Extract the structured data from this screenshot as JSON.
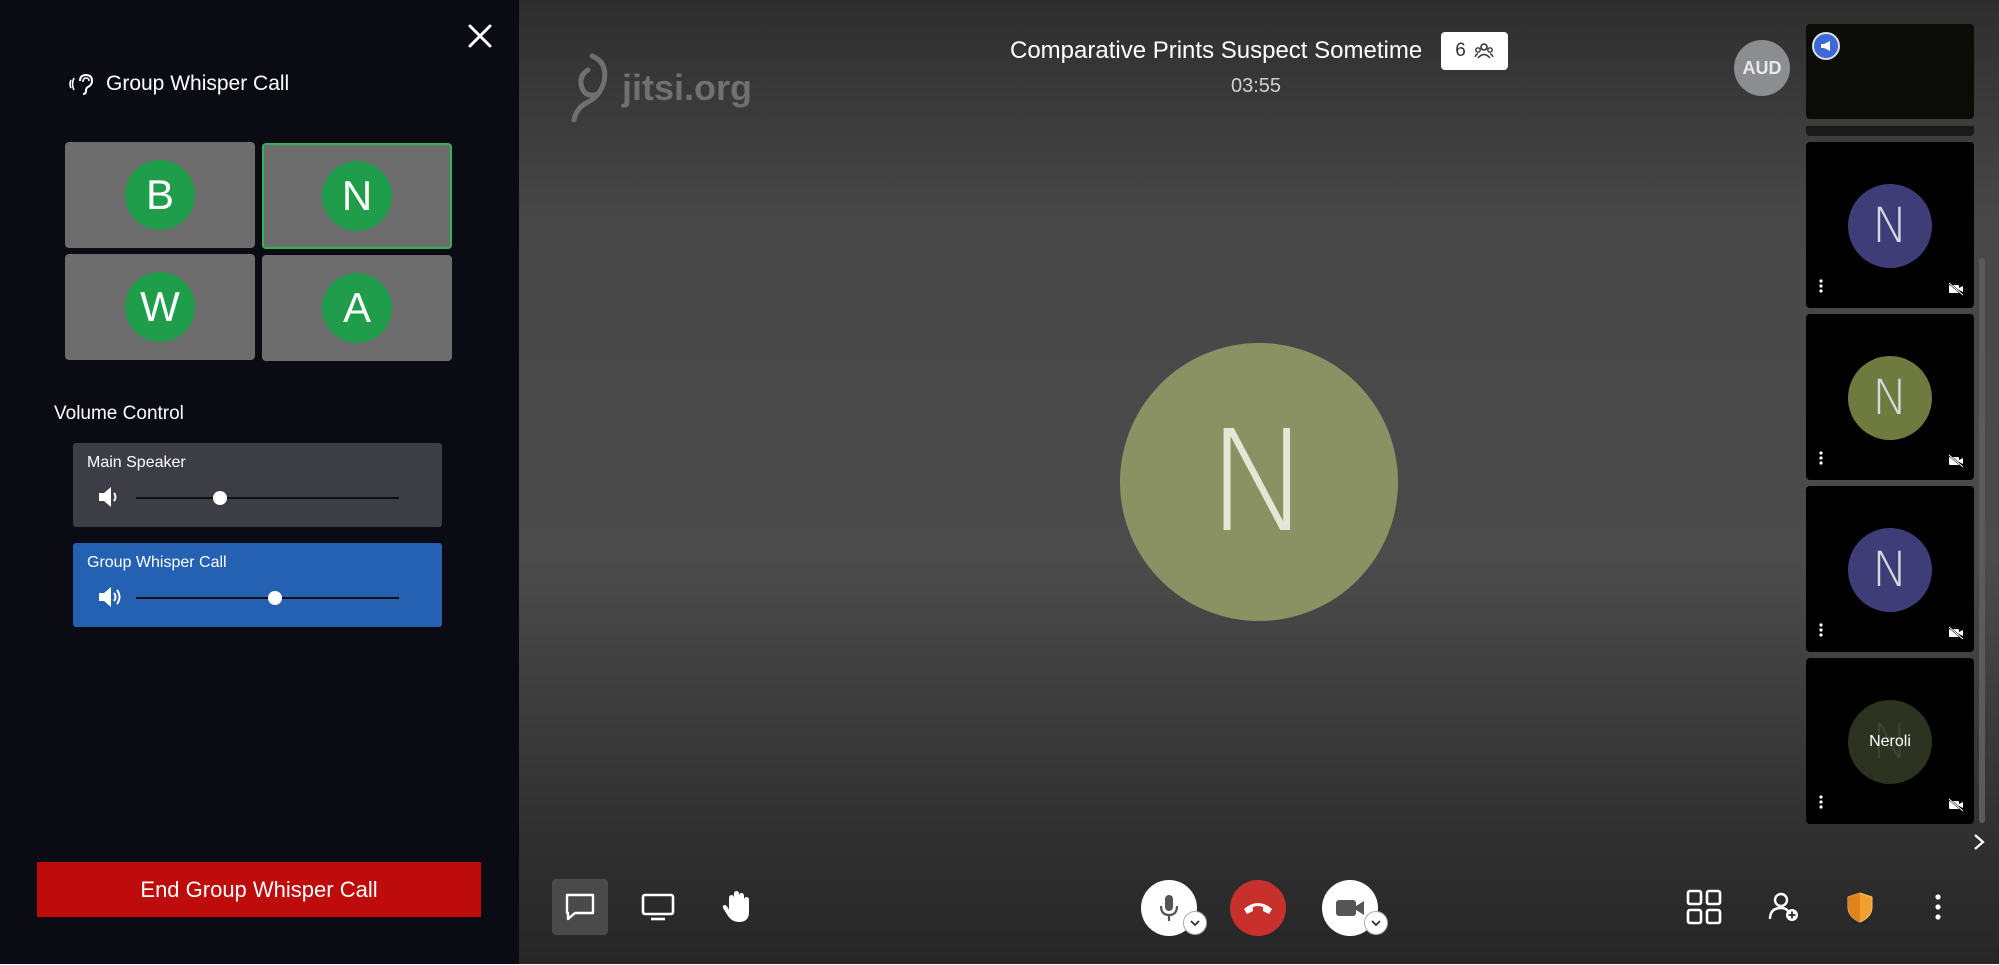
{
  "whisper_panel": {
    "title": "Group Whisper Call",
    "participants": [
      {
        "initial": "B",
        "active": false
      },
      {
        "initial": "N",
        "active": true
      },
      {
        "initial": "W",
        "active": false
      },
      {
        "initial": "A",
        "active": false
      }
    ],
    "volume_heading": "Volume Control",
    "volumes": [
      {
        "label": "Main Speaker",
        "level": 0.32
      },
      {
        "label": "Group Whisper Call",
        "level": 0.53
      }
    ],
    "end_button": "End Group Whisper Call"
  },
  "meeting": {
    "watermark": "jitsi.org",
    "title": "Comparative Prints Suspect Sometime",
    "timer": "03:55",
    "participant_count": "6",
    "local_avatar": "AUD",
    "dominant_initial": "N"
  },
  "filmstrip": {
    "thumbnails": [
      {
        "initial": "N",
        "color": "#3f3d77",
        "name": ""
      },
      {
        "initial": "N",
        "color": "#6f7a3e",
        "name": ""
      },
      {
        "initial": "N",
        "color": "#3f3d77",
        "name": ""
      },
      {
        "initial": "N",
        "color": "#2c3320",
        "name": "Neroli"
      }
    ]
  },
  "colors": {
    "accent_green": "#1f9d4a",
    "end_red": "#be0b0b",
    "whisper_blue": "#2461b3"
  }
}
